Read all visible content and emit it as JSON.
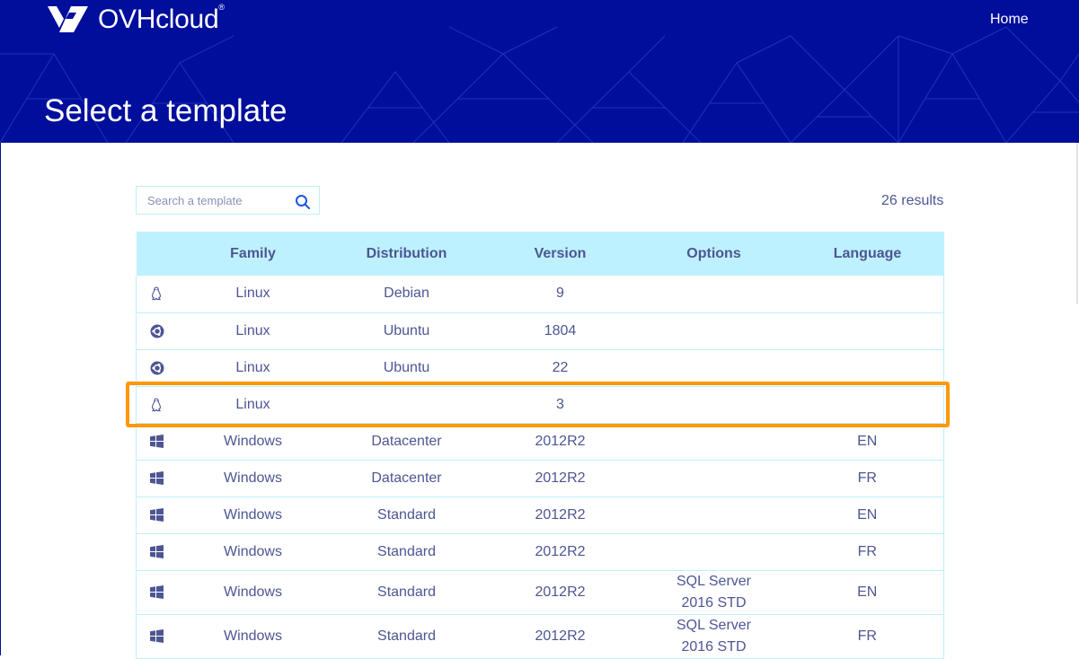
{
  "brand": {
    "name": "OVHcloud",
    "registered": "®"
  },
  "nav": {
    "home": "Home"
  },
  "page": {
    "title": "Select a template"
  },
  "search": {
    "placeholder": "Search a template",
    "value": ""
  },
  "results_label": "26 results",
  "table": {
    "headers": [
      "",
      "Family",
      "Distribution",
      "Version",
      "Options",
      "Language"
    ],
    "rows": [
      {
        "icon": "linux-icon",
        "family": "Linux",
        "distribution": "Debian",
        "version": "9",
        "options": "",
        "language": ""
      },
      {
        "icon": "ubuntu-icon",
        "family": "Linux",
        "distribution": "Ubuntu",
        "version": "1804",
        "options": "",
        "language": ""
      },
      {
        "icon": "ubuntu-icon",
        "family": "Linux",
        "distribution": "Ubuntu",
        "version": "22",
        "options": "",
        "language": ""
      },
      {
        "icon": "linux-icon",
        "family": "Linux",
        "distribution": "",
        "version": "3",
        "options": "",
        "language": "",
        "highlighted": true
      },
      {
        "icon": "windows-icon",
        "family": "Windows",
        "distribution": "Datacenter",
        "version": "2012R2",
        "options": "",
        "language": "EN"
      },
      {
        "icon": "windows-icon",
        "family": "Windows",
        "distribution": "Datacenter",
        "version": "2012R2",
        "options": "",
        "language": "FR"
      },
      {
        "icon": "windows-icon",
        "family": "Windows",
        "distribution": "Standard",
        "version": "2012R2",
        "options": "",
        "language": "EN"
      },
      {
        "icon": "windows-icon",
        "family": "Windows",
        "distribution": "Standard",
        "version": "2012R2",
        "options": "",
        "language": "FR"
      },
      {
        "icon": "windows-icon",
        "family": "Windows",
        "distribution": "Standard",
        "version": "2012R2",
        "options": "SQL Server 2016 STD",
        "language": "EN"
      },
      {
        "icon": "windows-icon",
        "family": "Windows",
        "distribution": "Standard",
        "version": "2012R2",
        "options": "SQL Server 2016 STD",
        "language": "FR"
      }
    ]
  },
  "colors": {
    "hero_bg": "#000e9c",
    "header_row_bg": "#bef1ff",
    "table_text": "#4d5693",
    "highlight": "#ff9803"
  }
}
